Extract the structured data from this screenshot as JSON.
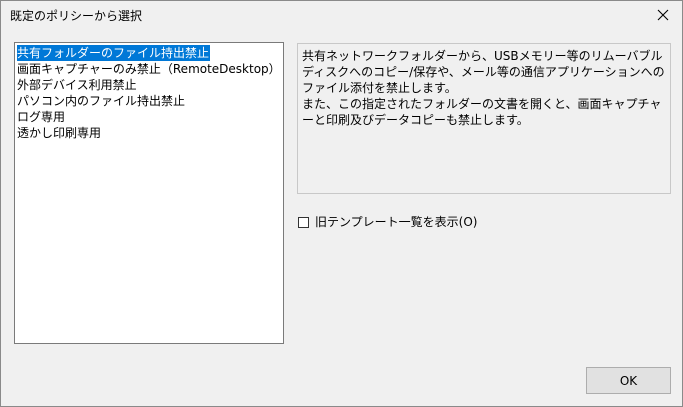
{
  "window": {
    "title": "既定のポリシーから選択"
  },
  "icons": {
    "close": "close-icon"
  },
  "policy_list": {
    "items": [
      {
        "label": "共有フォルダーのファイル持出禁止",
        "selected": true
      },
      {
        "label": "画面キャプチャーのみ禁止（RemoteDesktop）",
        "selected": false
      },
      {
        "label": "外部デバイス利用禁止",
        "selected": false
      },
      {
        "label": "パソコン内のファイル持出禁止",
        "selected": false
      },
      {
        "label": "ログ専用",
        "selected": false
      },
      {
        "label": "透かし印刷専用",
        "selected": false
      }
    ]
  },
  "description": {
    "lines": [
      "共有ネットワークフォルダーから、USBメモリー等のリムーバブルディスクへのコピー/保存や、メール等の通信アプリケーションへのファイル添付を禁止します。",
      "また、この指定されたフォルダーの文書を開くと、画面キャプチャーと印刷及びデータコピーも禁止します。"
    ]
  },
  "legacy_templates": {
    "label": "旧テンプレート一覧を表示(O)",
    "checked": false
  },
  "buttons": {
    "ok": "OK"
  },
  "colors": {
    "selection": "#0078d7",
    "background": "#f0f0f0"
  }
}
